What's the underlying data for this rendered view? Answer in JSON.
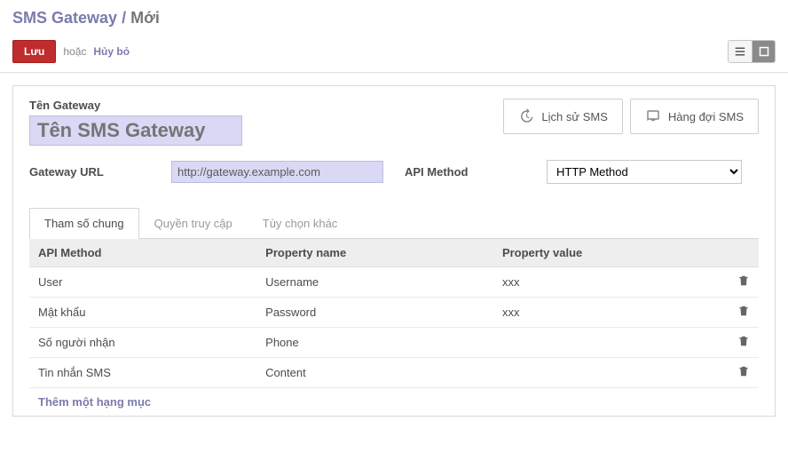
{
  "breadcrumb": {
    "root": "SMS Gateway",
    "sep": "/",
    "current": "Mới"
  },
  "actions": {
    "save": "Lưu",
    "or": "hoặc",
    "discard": "Hủy bỏ"
  },
  "sheet": {
    "name_label": "Tên Gateway",
    "name_placeholder": "Tên SMS Gateway",
    "url_label": "Gateway URL",
    "url_value": "http://gateway.example.com",
    "method_label": "API Method",
    "method_value": "HTTP Method"
  },
  "stat_buttons": {
    "history": "Lịch sử SMS",
    "queue": "Hàng đợi SMS"
  },
  "tabs": {
    "general": "Tham số chung",
    "access": "Quyền truy cập",
    "other": "Tùy chọn khác"
  },
  "grid": {
    "headers": {
      "method": "API Method",
      "pname": "Property name",
      "pvalue": "Property value"
    },
    "rows": [
      {
        "method": "User",
        "pname": "Username",
        "pvalue": "xxx"
      },
      {
        "method": "Mật khẩu",
        "pname": "Password",
        "pvalue": "xxx"
      },
      {
        "method": "Số người nhận",
        "pname": "Phone",
        "pvalue": ""
      },
      {
        "method": "Tin nhắn SMS",
        "pname": "Content",
        "pvalue": ""
      }
    ],
    "add_label": "Thêm một hạng mục"
  }
}
